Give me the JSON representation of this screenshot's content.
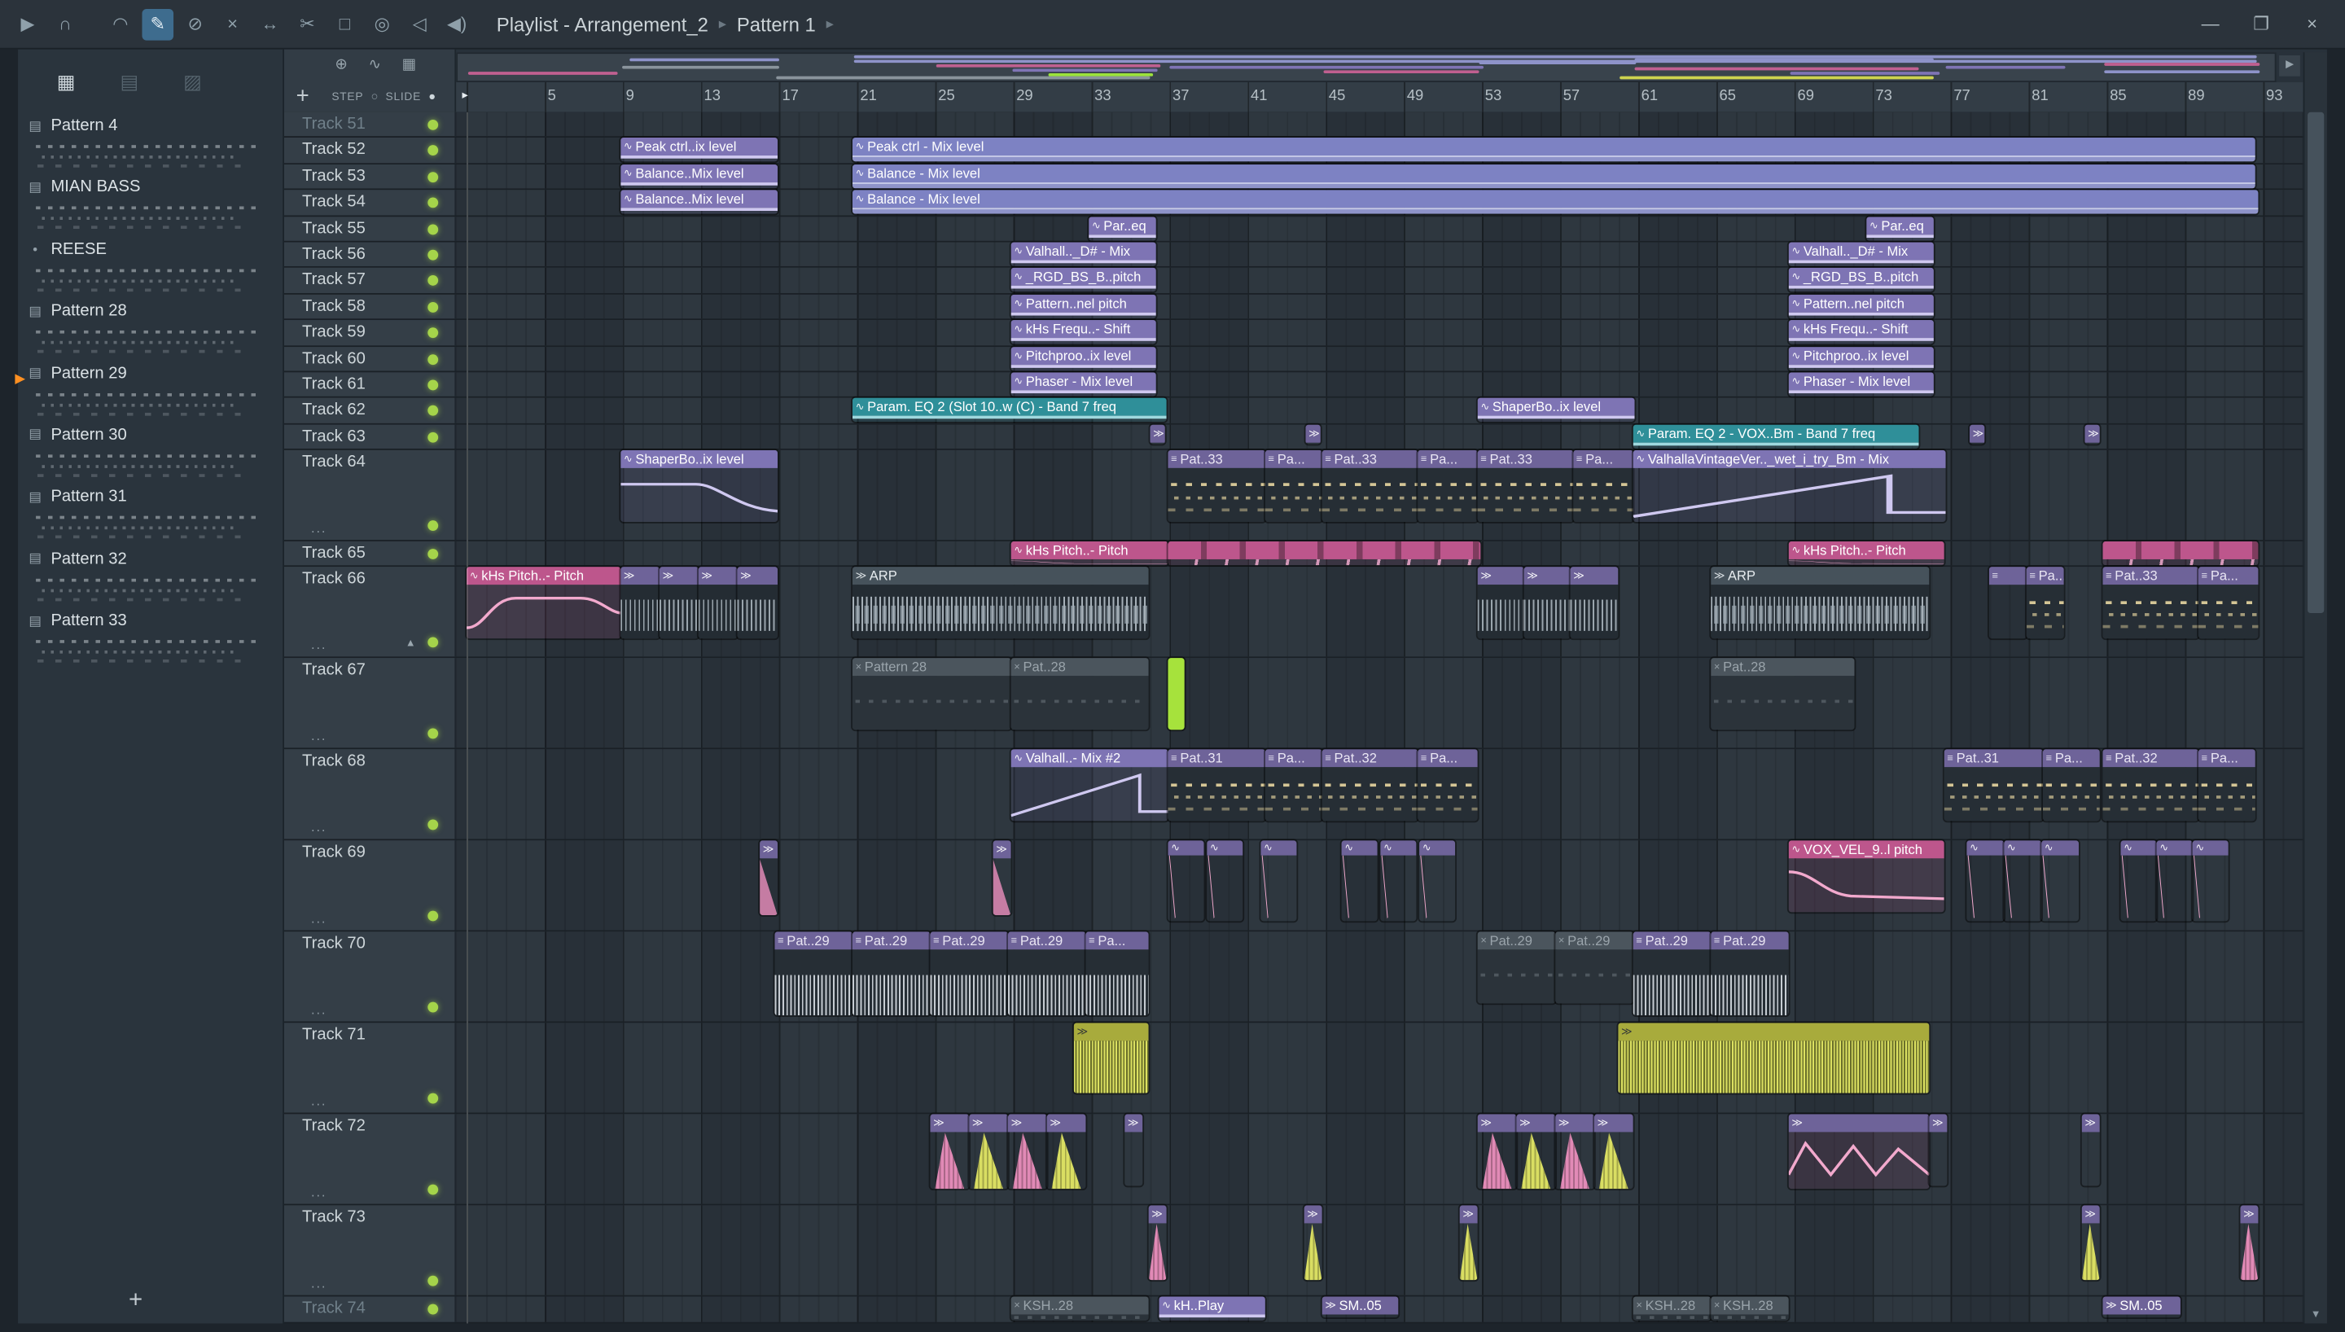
{
  "colors": {
    "lav": "#8e93c9",
    "pink": "#c06090",
    "pur": "#7f74b5",
    "grn": "#9ce23c",
    "yel": "#cdd34f",
    "gry": "#8a949c",
    "accent_green": "#a5d44a",
    "teal": "#2f8f99",
    "label_purple": "#7e74b4",
    "pattern_purple": "#6e6399",
    "muted_gray": "#4b555d",
    "yellow_clip": "#a8ab3c",
    "pink_clip": "#bd568c"
  },
  "toolbar": {
    "title": "Playlist - Arrangement_2",
    "subtitle": "Pattern 1",
    "separator": "▸",
    "icons": [
      {
        "name": "play-icon",
        "glyph": "▶"
      },
      {
        "name": "headphones-icon",
        "glyph": "∩",
        "gap": true
      },
      {
        "name": "snap-magnet-icon",
        "glyph": "◠"
      },
      {
        "name": "draw-tool-icon",
        "glyph": "✎",
        "active": true
      },
      {
        "name": "delete-tool-icon",
        "glyph": "⊘"
      },
      {
        "name": "mute-tool-icon",
        "glyph": "×"
      },
      {
        "name": "slip-tool-icon",
        "glyph": "↔"
      },
      {
        "name": "slice-tool-icon",
        "glyph": "✂"
      },
      {
        "name": "select-tool-icon",
        "glyph": "□"
      },
      {
        "name": "zoom-tool-icon",
        "glyph": "◎"
      },
      {
        "name": "playback-tool-icon",
        "glyph": "◁"
      },
      {
        "name": "audition-speaker-icon",
        "glyph": "◀)"
      }
    ],
    "window_controls": {
      "minimize": "—",
      "maximize": "❐",
      "close": "×"
    }
  },
  "picker": {
    "header_icons": [
      {
        "name": "patterns-view-icon",
        "glyph": "▦",
        "on": true
      },
      {
        "name": "audio-view-icon",
        "glyph": "▤",
        "on": false
      },
      {
        "name": "automation-view-icon",
        "glyph": "▨",
        "on": false
      }
    ],
    "items": [
      {
        "label": "Pattern 4"
      },
      {
        "label": "MIAN BASS"
      },
      {
        "label": "REESE",
        "bullet": true
      },
      {
        "label": "Pattern 28"
      },
      {
        "label": "Pattern 29",
        "marker": true
      },
      {
        "label": "Pattern 30"
      },
      {
        "label": "Pattern 31"
      },
      {
        "label": "Pattern 32"
      },
      {
        "label": "Pattern 33"
      }
    ],
    "add_label": "+",
    "marker_glyph": "▶"
  },
  "playlist": {
    "tools": {
      "plus": "+",
      "step_label": "STEP",
      "slide_label": "SLIDE",
      "step_off": "○",
      "slide_on": "●",
      "corner_icons": [
        {
          "name": "snap-icon",
          "glyph": "⊕"
        },
        {
          "name": "swing-icon",
          "glyph": "∿"
        },
        {
          "name": "grid-icon",
          "glyph": "▦"
        }
      ]
    },
    "ruler": {
      "bars": [
        5,
        9,
        13,
        17,
        21,
        25,
        29,
        33,
        37,
        41,
        45,
        49,
        53,
        57,
        61,
        65,
        69,
        73,
        77,
        81,
        85,
        89,
        93
      ],
      "start_marker": "▸"
    },
    "scroll_right": "▶",
    "scroll_down": "▼",
    "tracks": [
      {
        "name": "Track 51",
        "tall": false,
        "dim": true
      },
      {
        "name": "Track 52",
        "tall": false
      },
      {
        "name": "Track 53",
        "tall": false
      },
      {
        "name": "Track 54",
        "tall": false
      },
      {
        "name": "Track 55",
        "tall": false
      },
      {
        "name": "Track 56",
        "tall": false
      },
      {
        "name": "Track 57",
        "tall": false
      },
      {
        "name": "Track 58",
        "tall": false
      },
      {
        "name": "Track 59",
        "tall": false
      },
      {
        "name": "Track 60",
        "tall": false
      },
      {
        "name": "Track 61",
        "tall": false
      },
      {
        "name": "Track 62",
        "tall": false
      },
      {
        "name": "Track 63",
        "tall": false
      },
      {
        "name": "Track 64",
        "tall": true
      },
      {
        "name": "Track 65",
        "tall": false
      },
      {
        "name": "Track 66",
        "tall": true,
        "arrow": true
      },
      {
        "name": "Track 67",
        "tall": true
      },
      {
        "name": "Track 68",
        "tall": true
      },
      {
        "name": "Track 69",
        "tall": true
      },
      {
        "name": "Track 70",
        "tall": true
      },
      {
        "name": "Track 71",
        "tall": true
      },
      {
        "name": "Track 72",
        "tall": true
      },
      {
        "name": "Track 73",
        "tall": true
      },
      {
        "name": "Track 74",
        "tall": false,
        "dim": true
      }
    ],
    "clips": [
      [
        1,
        415,
        105,
        "Peak ctrl..ix level",
        "autoS"
      ],
      [
        1,
        570,
        938,
        "Peak ctrl - Mix level",
        "autoFill"
      ],
      [
        2,
        415,
        105,
        "Balance..Mix level",
        "autoS"
      ],
      [
        2,
        570,
        938,
        "Balance - Mix level",
        "autoFill"
      ],
      [
        3,
        415,
        105,
        "Balance..Mix level",
        "autoS"
      ],
      [
        3,
        570,
        940,
        "Balance - Mix level",
        "autoFill"
      ],
      [
        4,
        728,
        45,
        "Par..eq",
        "autoS"
      ],
      [
        4,
        1248,
        45,
        "Par..eq",
        "autoS"
      ],
      [
        5,
        676,
        97,
        "Valhall.._D# - Mix",
        "autoS"
      ],
      [
        5,
        1196,
        97,
        "Valhall.._D# - Mix",
        "autoS"
      ],
      [
        6,
        676,
        97,
        "_RGD_BS_B..pitch",
        "autoS"
      ],
      [
        6,
        1196,
        97,
        "_RGD_BS_B..pitch",
        "autoS"
      ],
      [
        7,
        676,
        97,
        "Pattern..nel pitch",
        "autoS"
      ],
      [
        7,
        1196,
        97,
        "Pattern..nel pitch",
        "autoS"
      ],
      [
        8,
        676,
        97,
        "kHs Frequ..- Shift",
        "autoS"
      ],
      [
        8,
        1196,
        97,
        "kHs Frequ..- Shift",
        "autoS"
      ],
      [
        9,
        676,
        97,
        "Pitchproo..ix level",
        "autoS"
      ],
      [
        9,
        1196,
        97,
        "Pitchproo..ix level",
        "autoS"
      ],
      [
        10,
        676,
        97,
        "Phaser - Mix level",
        "autoS"
      ],
      [
        10,
        1196,
        97,
        "Phaser - Mix level",
        "autoS"
      ],
      [
        11,
        570,
        210,
        "Param. EQ 2 (Slot 10..w (C) - Band 7 freq",
        "teal"
      ],
      [
        11,
        988,
        105,
        "ShaperBo..ix level",
        "autoS"
      ],
      [
        12,
        769,
        10,
        "",
        "cue"
      ],
      [
        12,
        873,
        10,
        "",
        "cue"
      ],
      [
        12,
        1092,
        191,
        "Param. EQ 2 - VOX..Bm - Band 7 freq",
        "teal"
      ],
      [
        12,
        1317,
        10,
        "",
        "cue"
      ],
      [
        12,
        1394,
        10,
        "",
        "cue"
      ],
      [
        13,
        415,
        105,
        "ShaperBo..ix level",
        "shaper"
      ],
      [
        13,
        781,
        65,
        "Pat..33",
        "pat"
      ],
      [
        13,
        846,
        38,
        "Pa...",
        "pat"
      ],
      [
        13,
        884,
        64,
        "Pat..33",
        "pat"
      ],
      [
        13,
        948,
        40,
        "Pa...",
        "pat"
      ],
      [
        13,
        988,
        64,
        "Pat..33",
        "pat"
      ],
      [
        13,
        1052,
        40,
        "Pa...",
        "pat"
      ],
      [
        13,
        1092,
        209,
        "ValhallaVintageVer.._wet_i_try_Bm - Mix",
        "autoRise"
      ],
      [
        14,
        676,
        105,
        "kHs Pitch..- Pitch",
        "pink"
      ],
      [
        14,
        781,
        209,
        "",
        "pinkMulti"
      ],
      [
        14,
        1196,
        104,
        "kHs Pitch..- Pitch",
        "pink"
      ],
      [
        14,
        1406,
        104,
        "",
        "pinkMulti"
      ],
      [
        15,
        312,
        103,
        "kHs Pitch..- Pitch",
        "pinkCurve"
      ],
      [
        15,
        415,
        26,
        "",
        "waveS"
      ],
      [
        15,
        441,
        26,
        "",
        "waveS"
      ],
      [
        15,
        467,
        26,
        "",
        "waveS"
      ],
      [
        15,
        493,
        27,
        "",
        "waveS"
      ],
      [
        15,
        570,
        198,
        "ARP",
        "audio"
      ],
      [
        15,
        988,
        31,
        "",
        "waveS"
      ],
      [
        15,
        1019,
        31,
        "",
        "waveS"
      ],
      [
        15,
        1050,
        32,
        "",
        "waveS"
      ],
      [
        15,
        1144,
        146,
        "ARP",
        "audio"
      ],
      [
        15,
        1330,
        25,
        "",
        "patS"
      ],
      [
        15,
        1355,
        25,
        "Pa...",
        "pat"
      ],
      [
        15,
        1406,
        64,
        "Pat..33",
        "pat"
      ],
      [
        15,
        1470,
        40,
        "Pa...",
        "pat"
      ],
      [
        16,
        570,
        106,
        "Pattern 28",
        "patMute"
      ],
      [
        16,
        676,
        92,
        "Pat..28",
        "patMute"
      ],
      [
        16,
        781,
        11,
        "",
        "green"
      ],
      [
        16,
        1144,
        96,
        "Pat..28",
        "patMute"
      ],
      [
        17,
        676,
        105,
        "Valhall..- Mix #2",
        "autoRise"
      ],
      [
        17,
        781,
        65,
        "Pat..31",
        "pat"
      ],
      [
        17,
        846,
        38,
        "Pa...",
        "pat"
      ],
      [
        17,
        884,
        64,
        "Pat..32",
        "pat"
      ],
      [
        17,
        948,
        40,
        "Pa...",
        "pat"
      ],
      [
        17,
        1300,
        66,
        "Pat..31",
        "pat"
      ],
      [
        17,
        1366,
        38,
        "Pa...",
        "pat"
      ],
      [
        17,
        1406,
        64,
        "Pat..32",
        "pat"
      ],
      [
        17,
        1470,
        38,
        "Pa...",
        "pat"
      ],
      [
        18,
        508,
        12,
        "",
        "rampPink"
      ],
      [
        18,
        664,
        12,
        "",
        "rampPink"
      ],
      [
        18,
        781,
        24,
        "",
        "spike"
      ],
      [
        18,
        807,
        24,
        "",
        "spike"
      ],
      [
        18,
        843,
        24,
        "",
        "spike"
      ],
      [
        18,
        897,
        24,
        "",
        "spike"
      ],
      [
        18,
        923,
        24,
        "",
        "spike"
      ],
      [
        18,
        949,
        24,
        "",
        "spike"
      ],
      [
        18,
        1196,
        104,
        "VOX_VEL_9..l pitch",
        "pink"
      ],
      [
        18,
        1315,
        25,
        "",
        "spike"
      ],
      [
        18,
        1340,
        25,
        "",
        "spike"
      ],
      [
        18,
        1365,
        25,
        "",
        "spike"
      ],
      [
        18,
        1418,
        24,
        "",
        "spike"
      ],
      [
        18,
        1442,
        24,
        "",
        "spike"
      ],
      [
        18,
        1466,
        24,
        "",
        "spike"
      ],
      [
        19,
        518,
        52,
        "Pat..29",
        "patDense"
      ],
      [
        19,
        570,
        52,
        "Pat..29",
        "patDense"
      ],
      [
        19,
        622,
        52,
        "Pat..29",
        "patDense"
      ],
      [
        19,
        674,
        52,
        "Pat..29",
        "patDense"
      ],
      [
        19,
        726,
        42,
        "Pa...",
        "patDense"
      ],
      [
        19,
        988,
        52,
        "Pat..29",
        "patMute"
      ],
      [
        19,
        1040,
        52,
        "Pat..29",
        "patMute"
      ],
      [
        19,
        1092,
        52,
        "Pat..29",
        "patDense"
      ],
      [
        19,
        1144,
        52,
        "Pat..29",
        "patDense"
      ],
      [
        20,
        718,
        50,
        "",
        "waveY"
      ],
      [
        20,
        1082,
        208,
        "",
        "waveY"
      ],
      [
        21,
        622,
        26,
        "",
        "hitP"
      ],
      [
        21,
        648,
        26,
        "",
        "hitY"
      ],
      [
        21,
        674,
        26,
        "",
        "hitP"
      ],
      [
        21,
        700,
        26,
        "",
        "hitY"
      ],
      [
        21,
        752,
        12,
        "",
        "cue"
      ],
      [
        21,
        988,
        26,
        "",
        "hitP"
      ],
      [
        21,
        1014,
        26,
        "",
        "hitY"
      ],
      [
        21,
        1040,
        26,
        "",
        "hitP"
      ],
      [
        21,
        1066,
        26,
        "",
        "hitY"
      ],
      [
        21,
        1196,
        94,
        "",
        "hitPwide"
      ],
      [
        21,
        1290,
        12,
        "",
        "cue"
      ],
      [
        21,
        1392,
        12,
        "",
        "cue"
      ],
      [
        22,
        768,
        12,
        "",
        "hitP2"
      ],
      [
        22,
        872,
        12,
        "",
        "hitY2"
      ],
      [
        22,
        976,
        12,
        "",
        "hitY2"
      ],
      [
        22,
        1392,
        12,
        "",
        "hitY2"
      ],
      [
        22,
        1498,
        12,
        "",
        "hitP2"
      ],
      [
        23,
        676,
        92,
        "KSH..28",
        "patMute"
      ],
      [
        23,
        775,
        71,
        "kH..Play",
        "autoS"
      ],
      [
        23,
        884,
        51,
        "SM..05",
        "cueL"
      ],
      [
        23,
        1092,
        52,
        "KSH..28",
        "patMute"
      ],
      [
        23,
        1144,
        52,
        "KSH..28",
        "patMute"
      ],
      [
        23,
        1406,
        52,
        "SM..05",
        "cueL"
      ]
    ],
    "overview_segments": [
      [
        312,
        100,
        12,
        "pink"
      ],
      [
        415,
        105,
        8,
        "gry"
      ],
      [
        420,
        100,
        3,
        "lav"
      ],
      [
        518,
        250,
        15,
        "gry"
      ],
      [
        570,
        938,
        1,
        "lav"
      ],
      [
        570,
        938,
        4,
        "lav"
      ],
      [
        625,
        150,
        7,
        "pink"
      ],
      [
        676,
        97,
        10,
        "pur"
      ],
      [
        700,
        70,
        13,
        "grn"
      ],
      [
        781,
        210,
        8,
        "pur"
      ],
      [
        884,
        104,
        11,
        "pink"
      ],
      [
        988,
        105,
        5,
        "lav"
      ],
      [
        1082,
        210,
        15,
        "yel"
      ],
      [
        1092,
        200,
        3,
        "lav"
      ],
      [
        1092,
        190,
        9,
        "pink"
      ],
      [
        1196,
        100,
        12,
        "pur"
      ],
      [
        1300,
        80,
        8,
        "pur"
      ],
      [
        1406,
        104,
        6,
        "pink"
      ],
      [
        1406,
        104,
        11,
        "lav"
      ]
    ]
  }
}
